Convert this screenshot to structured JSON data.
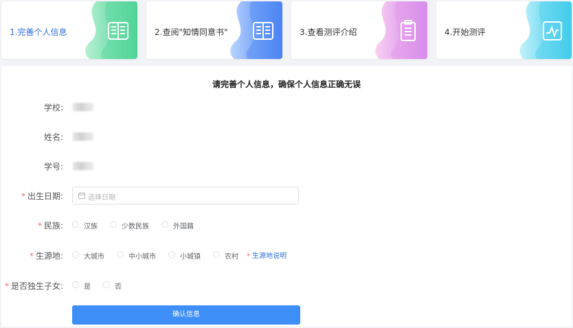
{
  "steps": [
    {
      "label": "1.完善个人信息",
      "icon": "book-icon"
    },
    {
      "label": "2.查阅\"知情同意书\"",
      "icon": "book-icon"
    },
    {
      "label": "3.查看测评介绍",
      "icon": "clipboard-icon"
    },
    {
      "label": "4.开始测评",
      "icon": "chart-line-icon"
    }
  ],
  "form": {
    "title": "请完善个人信息，确保个人信息正确无误",
    "school_label": "学校:",
    "name_label": "姓名:",
    "student_id_label": "学号:",
    "birthdate_label": "出生日期:",
    "birthdate_placeholder": "选择日期",
    "ethnicity_label": "民族:",
    "ethnicity_options": [
      "汉族",
      "少数民族",
      "外国籍"
    ],
    "origin_label": "生源地:",
    "origin_options": [
      "大城市",
      "中小城市",
      "小城镇",
      "农村"
    ],
    "origin_note": "生源地说明",
    "only_child_label": "是否独生子女:",
    "only_child_options": [
      "是",
      "否"
    ],
    "required_mark": "*",
    "confirm_button": "确认信息"
  },
  "colors": {
    "accent": "#3d8ef7",
    "active_step_text": "#2f6fe0",
    "required": "#f56c6c",
    "step1_gradient": [
      "#7fe3b0",
      "#3fcf8e"
    ],
    "step2_gradient": [
      "#7fb2ff",
      "#3b78f0"
    ],
    "step3_gradient": [
      "#f5a6e6",
      "#c87df0"
    ],
    "step4_gradient": [
      "#8fe6f5",
      "#2ac3e8"
    ]
  }
}
